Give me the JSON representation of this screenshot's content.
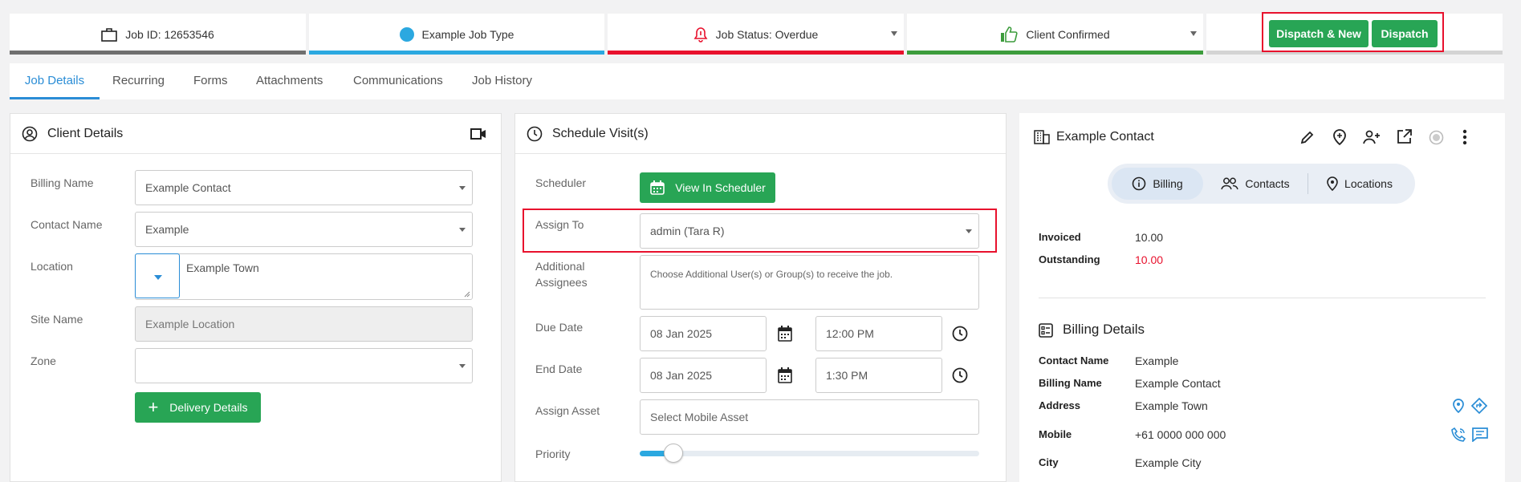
{
  "status_bar": {
    "job_id": "Job ID: 12653546",
    "job_type": "Example Job Type",
    "job_status": "Job Status: Overdue",
    "client_status": "Client Confirmed",
    "dispatch_new_label": "Dispatch & New",
    "dispatch_label": "Dispatch",
    "colors": {
      "job_id": "#6f6f6f",
      "job_type": "#2ba8e0",
      "job_status": "#e8112d",
      "client": "#3c9c3c"
    }
  },
  "tabs": [
    {
      "label": "Job Details",
      "active": true
    },
    {
      "label": "Recurring"
    },
    {
      "label": "Forms"
    },
    {
      "label": "Attachments"
    },
    {
      "label": "Communications"
    },
    {
      "label": "Job History"
    }
  ],
  "client_details": {
    "title": "Client Details",
    "billing_name_label": "Billing Name",
    "billing_name_value": "Example Contact",
    "contact_name_label": "Contact Name",
    "contact_name_value": "Example",
    "location_label": "Location",
    "location_value": "Example Town",
    "site_name_label": "Site Name",
    "site_name_placeholder": "Example Location",
    "zone_label": "Zone",
    "zone_value": "",
    "delivery_button": "Delivery Details"
  },
  "schedule": {
    "title": "Schedule Visit(s)",
    "scheduler_label": "Scheduler",
    "view_scheduler_button": "View In Scheduler",
    "assign_to_label": "Assign To",
    "assign_to_value": "admin (Tara R)",
    "additional_label_1": "Additional",
    "additional_label_2": "Assignees",
    "additional_placeholder": "Choose Additional User(s) or Group(s) to receive the job.",
    "due_date_label": "Due Date",
    "due_date": "08 Jan 2025",
    "due_time": "12:00 PM",
    "end_date_label": "End Date",
    "end_date": "08 Jan 2025",
    "end_time": "1:30 PM",
    "asset_label": "Assign Asset",
    "asset_placeholder": "Select Mobile Asset",
    "priority_label": "Priority",
    "priority_level": 0.07
  },
  "contact": {
    "title": "Example Contact",
    "toggle": [
      "Billing",
      "Contacts",
      "Locations"
    ],
    "invoiced_label": "Invoiced",
    "invoiced_value": "10.00",
    "outstanding_label": "Outstanding",
    "outstanding_value": "10.00",
    "billing_details_title": "Billing Details",
    "rows": [
      {
        "label": "Contact Name",
        "value": "Example"
      },
      {
        "label": "Billing Name",
        "value": "Example Contact"
      },
      {
        "label": "Address",
        "value": "Example Town"
      },
      {
        "label": "Mobile",
        "value": "+61 0000 000 000"
      },
      {
        "label": "City",
        "value": "Example City"
      }
    ]
  }
}
